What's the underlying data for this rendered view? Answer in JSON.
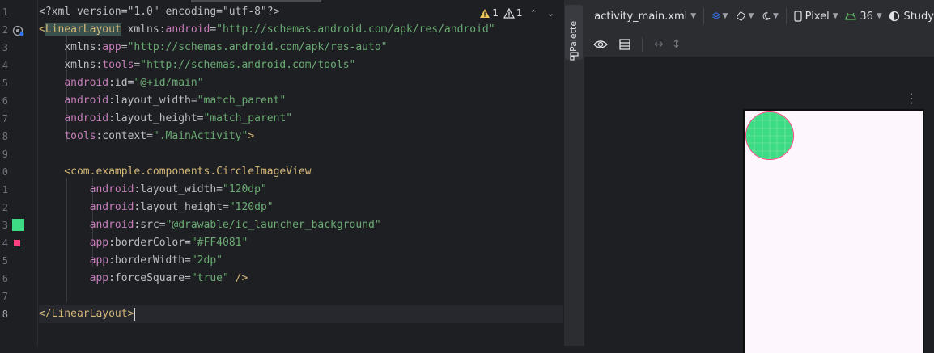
{
  "editor": {
    "gutter_lines": [
      {
        "number": "1",
        "marker": null
      },
      {
        "number": "2",
        "marker": "class-icon"
      },
      {
        "number": "3",
        "marker": null
      },
      {
        "number": "4",
        "marker": null
      },
      {
        "number": "5",
        "marker": null
      },
      {
        "number": "6",
        "marker": null
      },
      {
        "number": "7",
        "marker": null
      },
      {
        "number": "8",
        "marker": null
      },
      {
        "number": "9",
        "marker": null
      },
      {
        "number": "0",
        "marker": null
      },
      {
        "number": "1",
        "marker": null
      },
      {
        "number": "2",
        "marker": null
      },
      {
        "number": "3",
        "marker": "color-swatch-green"
      },
      {
        "number": "4",
        "marker": "color-swatch-pink"
      },
      {
        "number": "5",
        "marker": null
      },
      {
        "number": "6",
        "marker": null
      },
      {
        "number": "7",
        "marker": null
      },
      {
        "number": "8",
        "marker": null
      }
    ],
    "current_line": 18,
    "code_lines": [
      [
        {
          "t": "<?xml version=\"1.0\" encoding=\"utf-8\"?>",
          "c": "prolog"
        }
      ],
      [
        {
          "t": "<",
          "c": "tag"
        },
        {
          "t": "LinearLayout",
          "c": "tagname-hl"
        },
        {
          "t": " xmlns:",
          "c": "attr"
        },
        {
          "t": "android",
          "c": "ns"
        },
        {
          "t": "=",
          "c": "attr"
        },
        {
          "t": "\"http://schemas.android.com/apk/res/android\"",
          "c": "str"
        }
      ],
      [
        {
          "t": "    xmlns:",
          "c": "attr"
        },
        {
          "t": "app",
          "c": "ns"
        },
        {
          "t": "=",
          "c": "attr"
        },
        {
          "t": "\"http://schemas.android.com/apk/res-auto\"",
          "c": "str"
        }
      ],
      [
        {
          "t": "    xmlns:",
          "c": "attr"
        },
        {
          "t": "tools",
          "c": "ns"
        },
        {
          "t": "=",
          "c": "attr"
        },
        {
          "t": "\"http://schemas.android.com/tools\"",
          "c": "str"
        }
      ],
      [
        {
          "t": "    ",
          "c": "attr"
        },
        {
          "t": "android",
          "c": "ns"
        },
        {
          "t": ":id=",
          "c": "attr"
        },
        {
          "t": "\"@+id/main\"",
          "c": "str"
        }
      ],
      [
        {
          "t": "    ",
          "c": "attr"
        },
        {
          "t": "android",
          "c": "ns"
        },
        {
          "t": ":layout_width=",
          "c": "attr"
        },
        {
          "t": "\"match_parent\"",
          "c": "str"
        }
      ],
      [
        {
          "t": "    ",
          "c": "attr"
        },
        {
          "t": "android",
          "c": "ns"
        },
        {
          "t": ":layout_height=",
          "c": "attr"
        },
        {
          "t": "\"match_parent\"",
          "c": "str"
        }
      ],
      [
        {
          "t": "    ",
          "c": "attr"
        },
        {
          "t": "tools",
          "c": "ns"
        },
        {
          "t": ":context=",
          "c": "attr"
        },
        {
          "t": "\".MainActivity\"",
          "c": "str"
        },
        {
          "t": ">",
          "c": "tag"
        }
      ],
      [],
      [
        {
          "t": "    <",
          "c": "tag"
        },
        {
          "t": "com.example.components.CircleImageView",
          "c": "tagname"
        }
      ],
      [
        {
          "t": "        ",
          "c": "attr"
        },
        {
          "t": "android",
          "c": "ns"
        },
        {
          "t": ":layout_width=",
          "c": "attr"
        },
        {
          "t": "\"120dp\"",
          "c": "str"
        }
      ],
      [
        {
          "t": "        ",
          "c": "attr"
        },
        {
          "t": "android",
          "c": "ns"
        },
        {
          "t": ":layout_height=",
          "c": "attr"
        },
        {
          "t": "\"120dp\"",
          "c": "str"
        }
      ],
      [
        {
          "t": "        ",
          "c": "attr"
        },
        {
          "t": "android",
          "c": "ns"
        },
        {
          "t": ":src=",
          "c": "attr"
        },
        {
          "t": "\"@drawable/ic_launcher_background\"",
          "c": "str"
        }
      ],
      [
        {
          "t": "        ",
          "c": "attr"
        },
        {
          "t": "app",
          "c": "ns"
        },
        {
          "t": ":borderColor=",
          "c": "attr"
        },
        {
          "t": "\"#FF4081\"",
          "c": "str"
        }
      ],
      [
        {
          "t": "        ",
          "c": "attr"
        },
        {
          "t": "app",
          "c": "ns"
        },
        {
          "t": ":borderWidth=",
          "c": "attr"
        },
        {
          "t": "\"2dp\"",
          "c": "str"
        }
      ],
      [
        {
          "t": "        ",
          "c": "attr"
        },
        {
          "t": "app",
          "c": "ns"
        },
        {
          "t": ":forceSquare=",
          "c": "attr"
        },
        {
          "t": "\"true\"",
          "c": "str"
        },
        {
          "t": " />",
          "c": "tag"
        }
      ],
      [],
      [
        {
          "t": "</",
          "c": "tag"
        },
        {
          "t": "LinearLayout",
          "c": "tagname"
        },
        {
          "t": ">",
          "c": "tag"
        }
      ]
    ],
    "inspections": {
      "warnings_count": "1",
      "weak_warnings_count": "1"
    }
  },
  "palette": {
    "label": "Palette"
  },
  "design_toolbar": {
    "file": "activity_main.xml",
    "device": "Pixel",
    "api_level": "36",
    "theme": "Study"
  },
  "preview": {
    "border_color": "#FF4081",
    "image_fill": "#3ddc84",
    "background": "#fdf7fd"
  }
}
